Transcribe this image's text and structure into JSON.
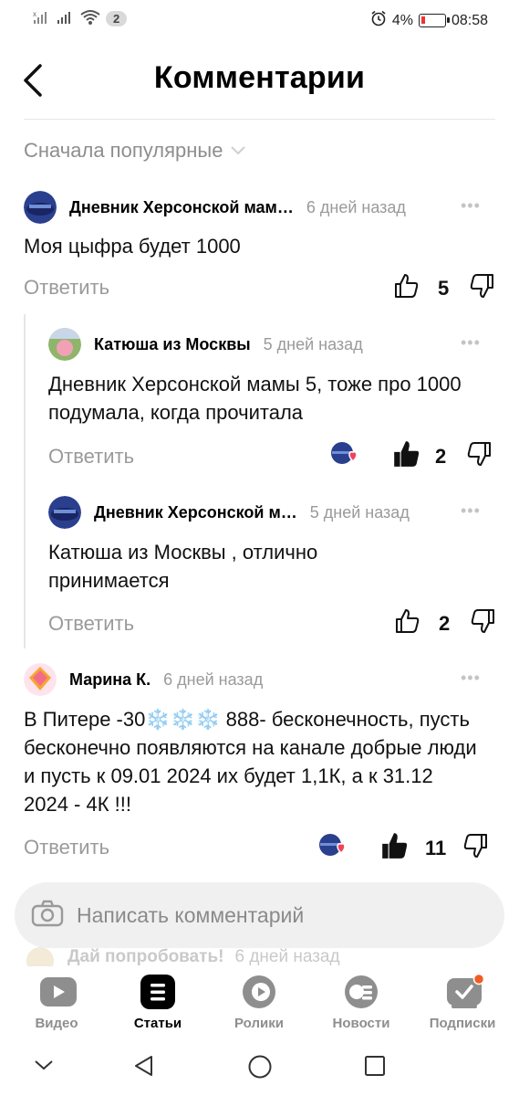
{
  "status_bar": {
    "notification_count": "2",
    "battery": "4%",
    "time": "08:58"
  },
  "header": {
    "title": "Комментарии"
  },
  "sort": {
    "label": "Сначала популярные"
  },
  "comments": [
    {
      "author": "Дневник Херсонской мам…",
      "time": "6 дней назад",
      "text": "Моя цыфра будет 1000",
      "reply_label": "Ответить",
      "likes": "5"
    },
    {
      "author": "Катюша из Москвы",
      "time": "5 дней назад",
      "text": "Дневник Херсонской мамы 5, тоже про 1000 подумала, когда прочитала",
      "reply_label": "Ответить",
      "likes": "2"
    },
    {
      "author": "Дневник Херсонской м…",
      "time": "5 дней назад",
      "text": "Катюша из Москвы , отлично принимается",
      "reply_label": "Ответить",
      "likes": "2"
    },
    {
      "author": "Марина К.",
      "time": "6 дней назад",
      "text": "В Питере -30❄️❄️❄️ 888- бесконечность, пусть бесконечно появляются на канале добрые люди и пусть к 09.01 2024 их будет 1,1К, а к 31.12 2024 - 4К !!!",
      "reply_label": "Ответить",
      "likes": "11"
    }
  ],
  "composer": {
    "placeholder": "Написать комментарий"
  },
  "peek": {
    "author": "Дай попробовать!",
    "time": "6 дней назад"
  },
  "bottom_nav": [
    {
      "label": "Видео",
      "icon": "video-icon"
    },
    {
      "label": "Статьи",
      "icon": "articles-icon"
    },
    {
      "label": "Ролики",
      "icon": "shorts-icon"
    },
    {
      "label": "Новости",
      "icon": "news-icon"
    },
    {
      "label": "Подписки",
      "icon": "subscriptions-icon"
    }
  ],
  "colors": {
    "accent": "#f05d23",
    "like_heart": "#f2425a",
    "muted_text": "#9a9a9a"
  }
}
